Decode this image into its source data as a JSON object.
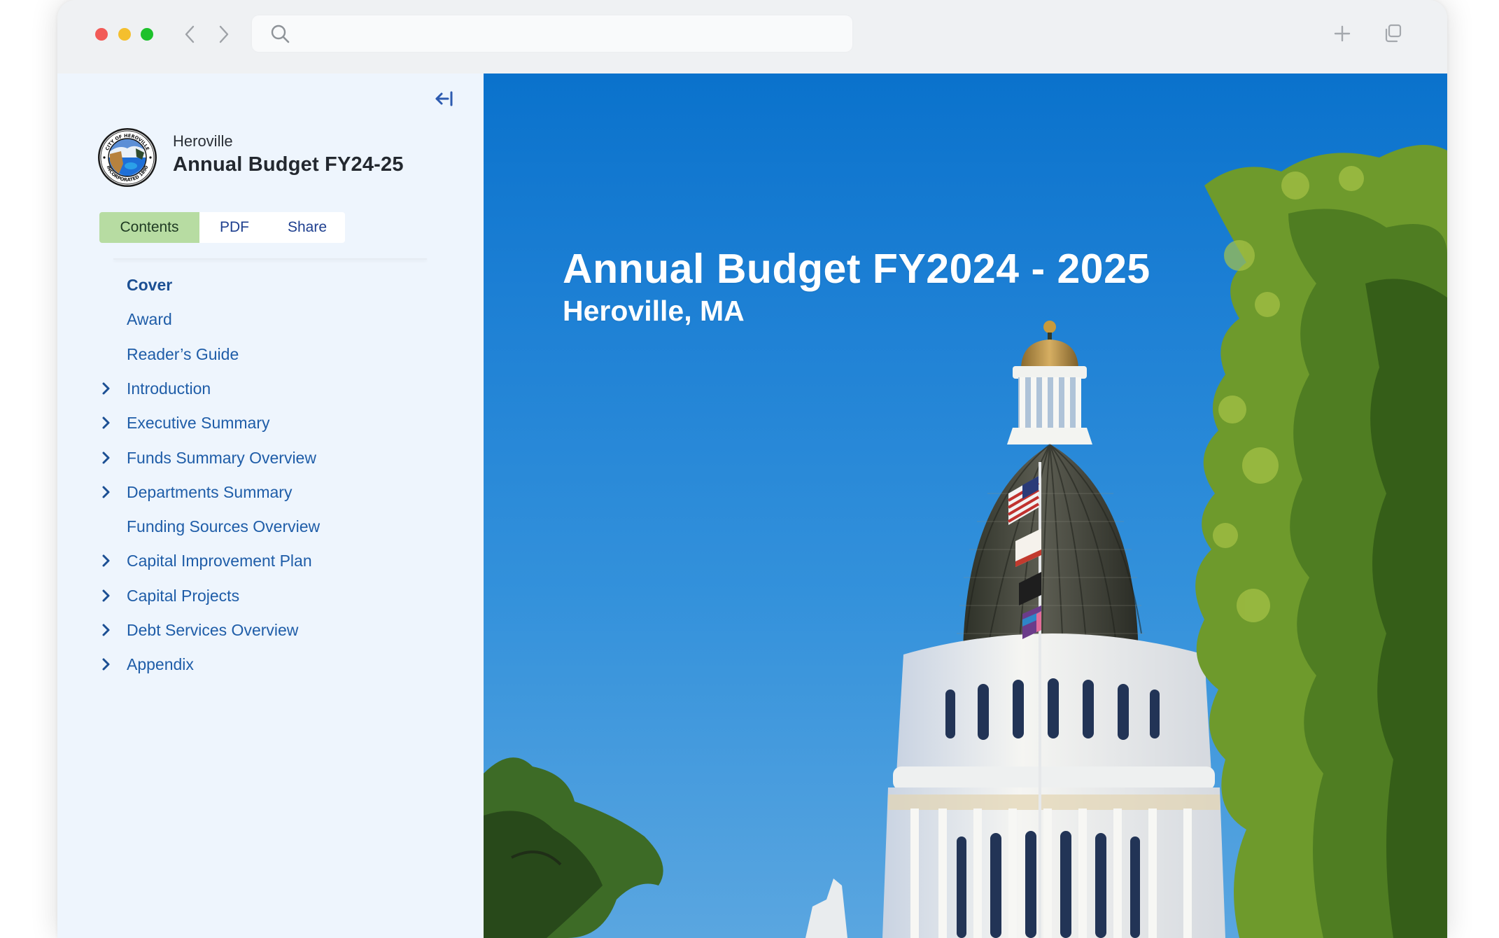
{
  "browser": {
    "search_placeholder": "",
    "search_value": "",
    "icons": {
      "back": "chevron-left-icon",
      "forward": "chevron-right-icon",
      "search": "search-icon",
      "new_tab": "plus-icon",
      "tabs": "tabs-overview-icon"
    },
    "traffic_lights": {
      "close": "#F25B57",
      "minimize": "#F4BF2E",
      "maximize": "#1DC12B"
    }
  },
  "sidebar": {
    "collapse_icon": "collapse-sidebar-icon",
    "org_name": "Heroville",
    "doc_title": "Annual Budget FY24-25",
    "seal": {
      "top_text": "CITY OF HEROVILLE",
      "bottom_text": "INCORPORATED 1890"
    },
    "tabs": [
      {
        "label": "Contents",
        "active": true
      },
      {
        "label": "PDF",
        "active": false
      },
      {
        "label": "Share",
        "active": false
      }
    ],
    "toc": [
      {
        "label": "Cover",
        "expandable": false,
        "active": true
      },
      {
        "label": "Award",
        "expandable": false,
        "active": false
      },
      {
        "label": "Reader’s Guide",
        "expandable": false,
        "active": false
      },
      {
        "label": "Introduction",
        "expandable": true,
        "active": false
      },
      {
        "label": "Executive Summary",
        "expandable": true,
        "active": false
      },
      {
        "label": "Funds Summary Overview",
        "expandable": true,
        "active": false
      },
      {
        "label": "Departments Summary",
        "expandable": true,
        "active": false
      },
      {
        "label": "Funding Sources Overview",
        "expandable": false,
        "active": false
      },
      {
        "label": "Capital Improvement Plan",
        "expandable": true,
        "active": false
      },
      {
        "label": "Capital Projects",
        "expandable": true,
        "active": false
      },
      {
        "label": "Debt Services Overview",
        "expandable": true,
        "active": false
      },
      {
        "label": "Appendix",
        "expandable": true,
        "active": false
      }
    ]
  },
  "cover": {
    "title": "Annual Budget FY2024 - 2025",
    "subtitle": "Heroville, MA",
    "image_description": "State capitol dome with flags against a blue sky, framed by trees"
  },
  "colors": {
    "accent_text": "#1F5DA8",
    "active_tab_bg": "#B7DCA2",
    "sidebar_bg": "#EEF5FD",
    "sky": "#1C7FD4"
  }
}
